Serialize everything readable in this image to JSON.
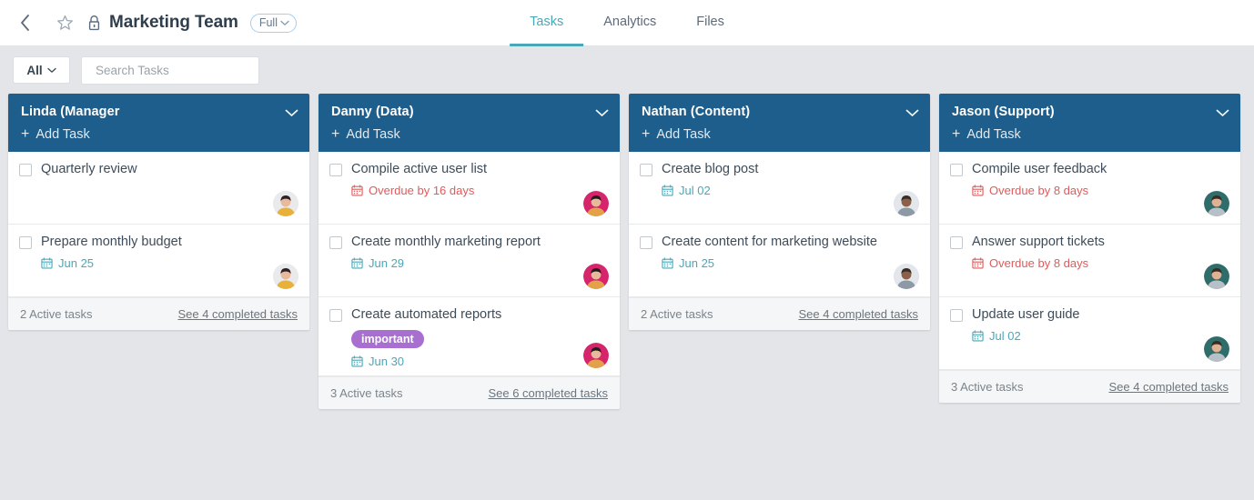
{
  "header": {
    "back_icon": "chevron-left-icon",
    "star_icon": "star-icon",
    "lock_icon": "lock-icon",
    "title": "Marketing Team",
    "visibility_label": "Full",
    "tabs": [
      {
        "label": "Tasks",
        "active": true
      },
      {
        "label": "Analytics",
        "active": false
      },
      {
        "label": "Files",
        "active": false
      }
    ]
  },
  "filterbar": {
    "filter_label": "All",
    "search_placeholder": "Search Tasks",
    "search_value": "",
    "search_icon": "search-icon"
  },
  "columns": [
    {
      "title": "Linda (Manager",
      "add_task_label": "Add Task",
      "avatar": "woman-dark-hair",
      "tasks": [
        {
          "title": "Quarterly review",
          "date": "",
          "date_state": "none",
          "tag": ""
        },
        {
          "title": "Prepare monthly budget",
          "date": "Jun 25",
          "date_state": "due",
          "tag": ""
        }
      ],
      "active_label": "2 Active tasks",
      "completed_label": "See 4 completed tasks"
    },
    {
      "title": "Danny (Data)",
      "add_task_label": "Add Task",
      "avatar": "man-pink",
      "tasks": [
        {
          "title": "Compile active user list",
          "date": "Overdue by 16 days",
          "date_state": "overdue",
          "tag": ""
        },
        {
          "title": "Create monthly marketing report",
          "date": "Jun 29",
          "date_state": "due",
          "tag": ""
        },
        {
          "title": "Create automated reports",
          "date": "Jun 30",
          "date_state": "due",
          "tag": "important"
        }
      ],
      "active_label": "3 Active tasks",
      "completed_label": "See 6 completed tasks"
    },
    {
      "title": "Nathan (Content)",
      "add_task_label": "Add Task",
      "avatar": "man-grey",
      "tasks": [
        {
          "title": "Create blog post",
          "date": "Jul 02",
          "date_state": "due",
          "tag": ""
        },
        {
          "title": "Create content for marketing website",
          "date": "Jun 25",
          "date_state": "due",
          "tag": ""
        }
      ],
      "active_label": "2 Active tasks",
      "completed_label": "See 4 completed tasks"
    },
    {
      "title": "Jason (Support)",
      "add_task_label": "Add Task",
      "avatar": "man-suit",
      "tasks": [
        {
          "title": "Compile user feedback",
          "date": "Overdue by 8 days",
          "date_state": "overdue",
          "tag": ""
        },
        {
          "title": "Answer support tickets",
          "date": "Overdue by 8 days",
          "date_state": "overdue",
          "tag": ""
        },
        {
          "title": "Update user guide",
          "date": "Jul 02",
          "date_state": "due",
          "tag": ""
        }
      ],
      "active_label": "3 Active tasks",
      "completed_label": "See 4 completed tasks"
    }
  ],
  "colors": {
    "column_header": "#1e5e8c",
    "accent_teal": "#4aa7b8",
    "overdue_red": "#e05a5a",
    "tag_purple": "#a86fd0",
    "page_bg": "#e4e5e9"
  }
}
